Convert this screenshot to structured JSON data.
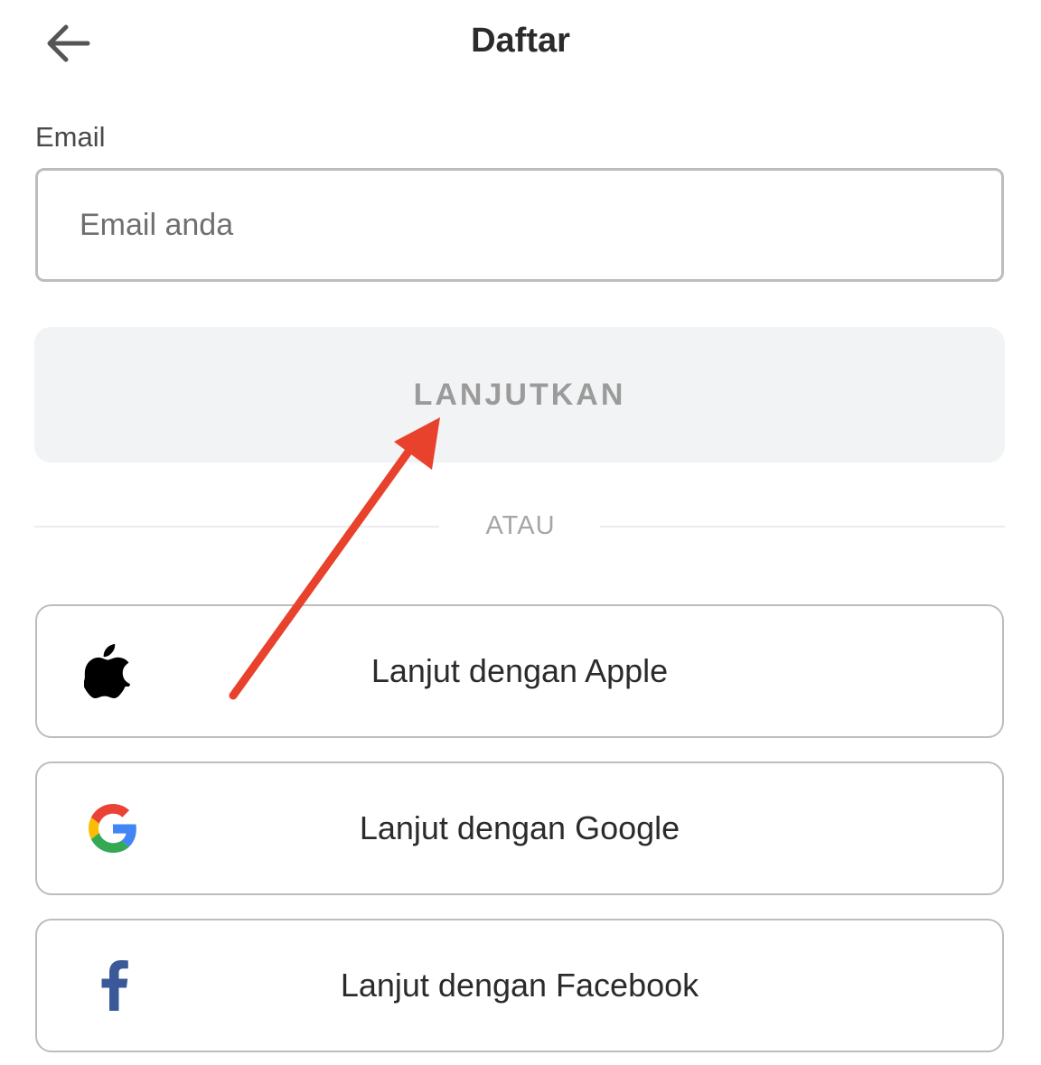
{
  "header": {
    "title": "Daftar",
    "back_icon": "arrow-left-icon"
  },
  "form": {
    "email_label": "Email",
    "email_placeholder": "Email anda",
    "email_value": "",
    "continue_label": "LANJUTKAN"
  },
  "divider": {
    "text": "ATAU"
  },
  "social": [
    {
      "label": "Lanjut dengan Apple",
      "icon": "apple-icon"
    },
    {
      "label": "Lanjut dengan Google",
      "icon": "google-icon"
    },
    {
      "label": "Lanjut dengan Facebook",
      "icon": "facebook-icon"
    }
  ],
  "colors": {
    "annotation_arrow": "#e8412c",
    "facebook_blue": "#3b5998",
    "disabled_button_bg": "#f2f3f4",
    "disabled_button_text": "#9b9b9b"
  }
}
